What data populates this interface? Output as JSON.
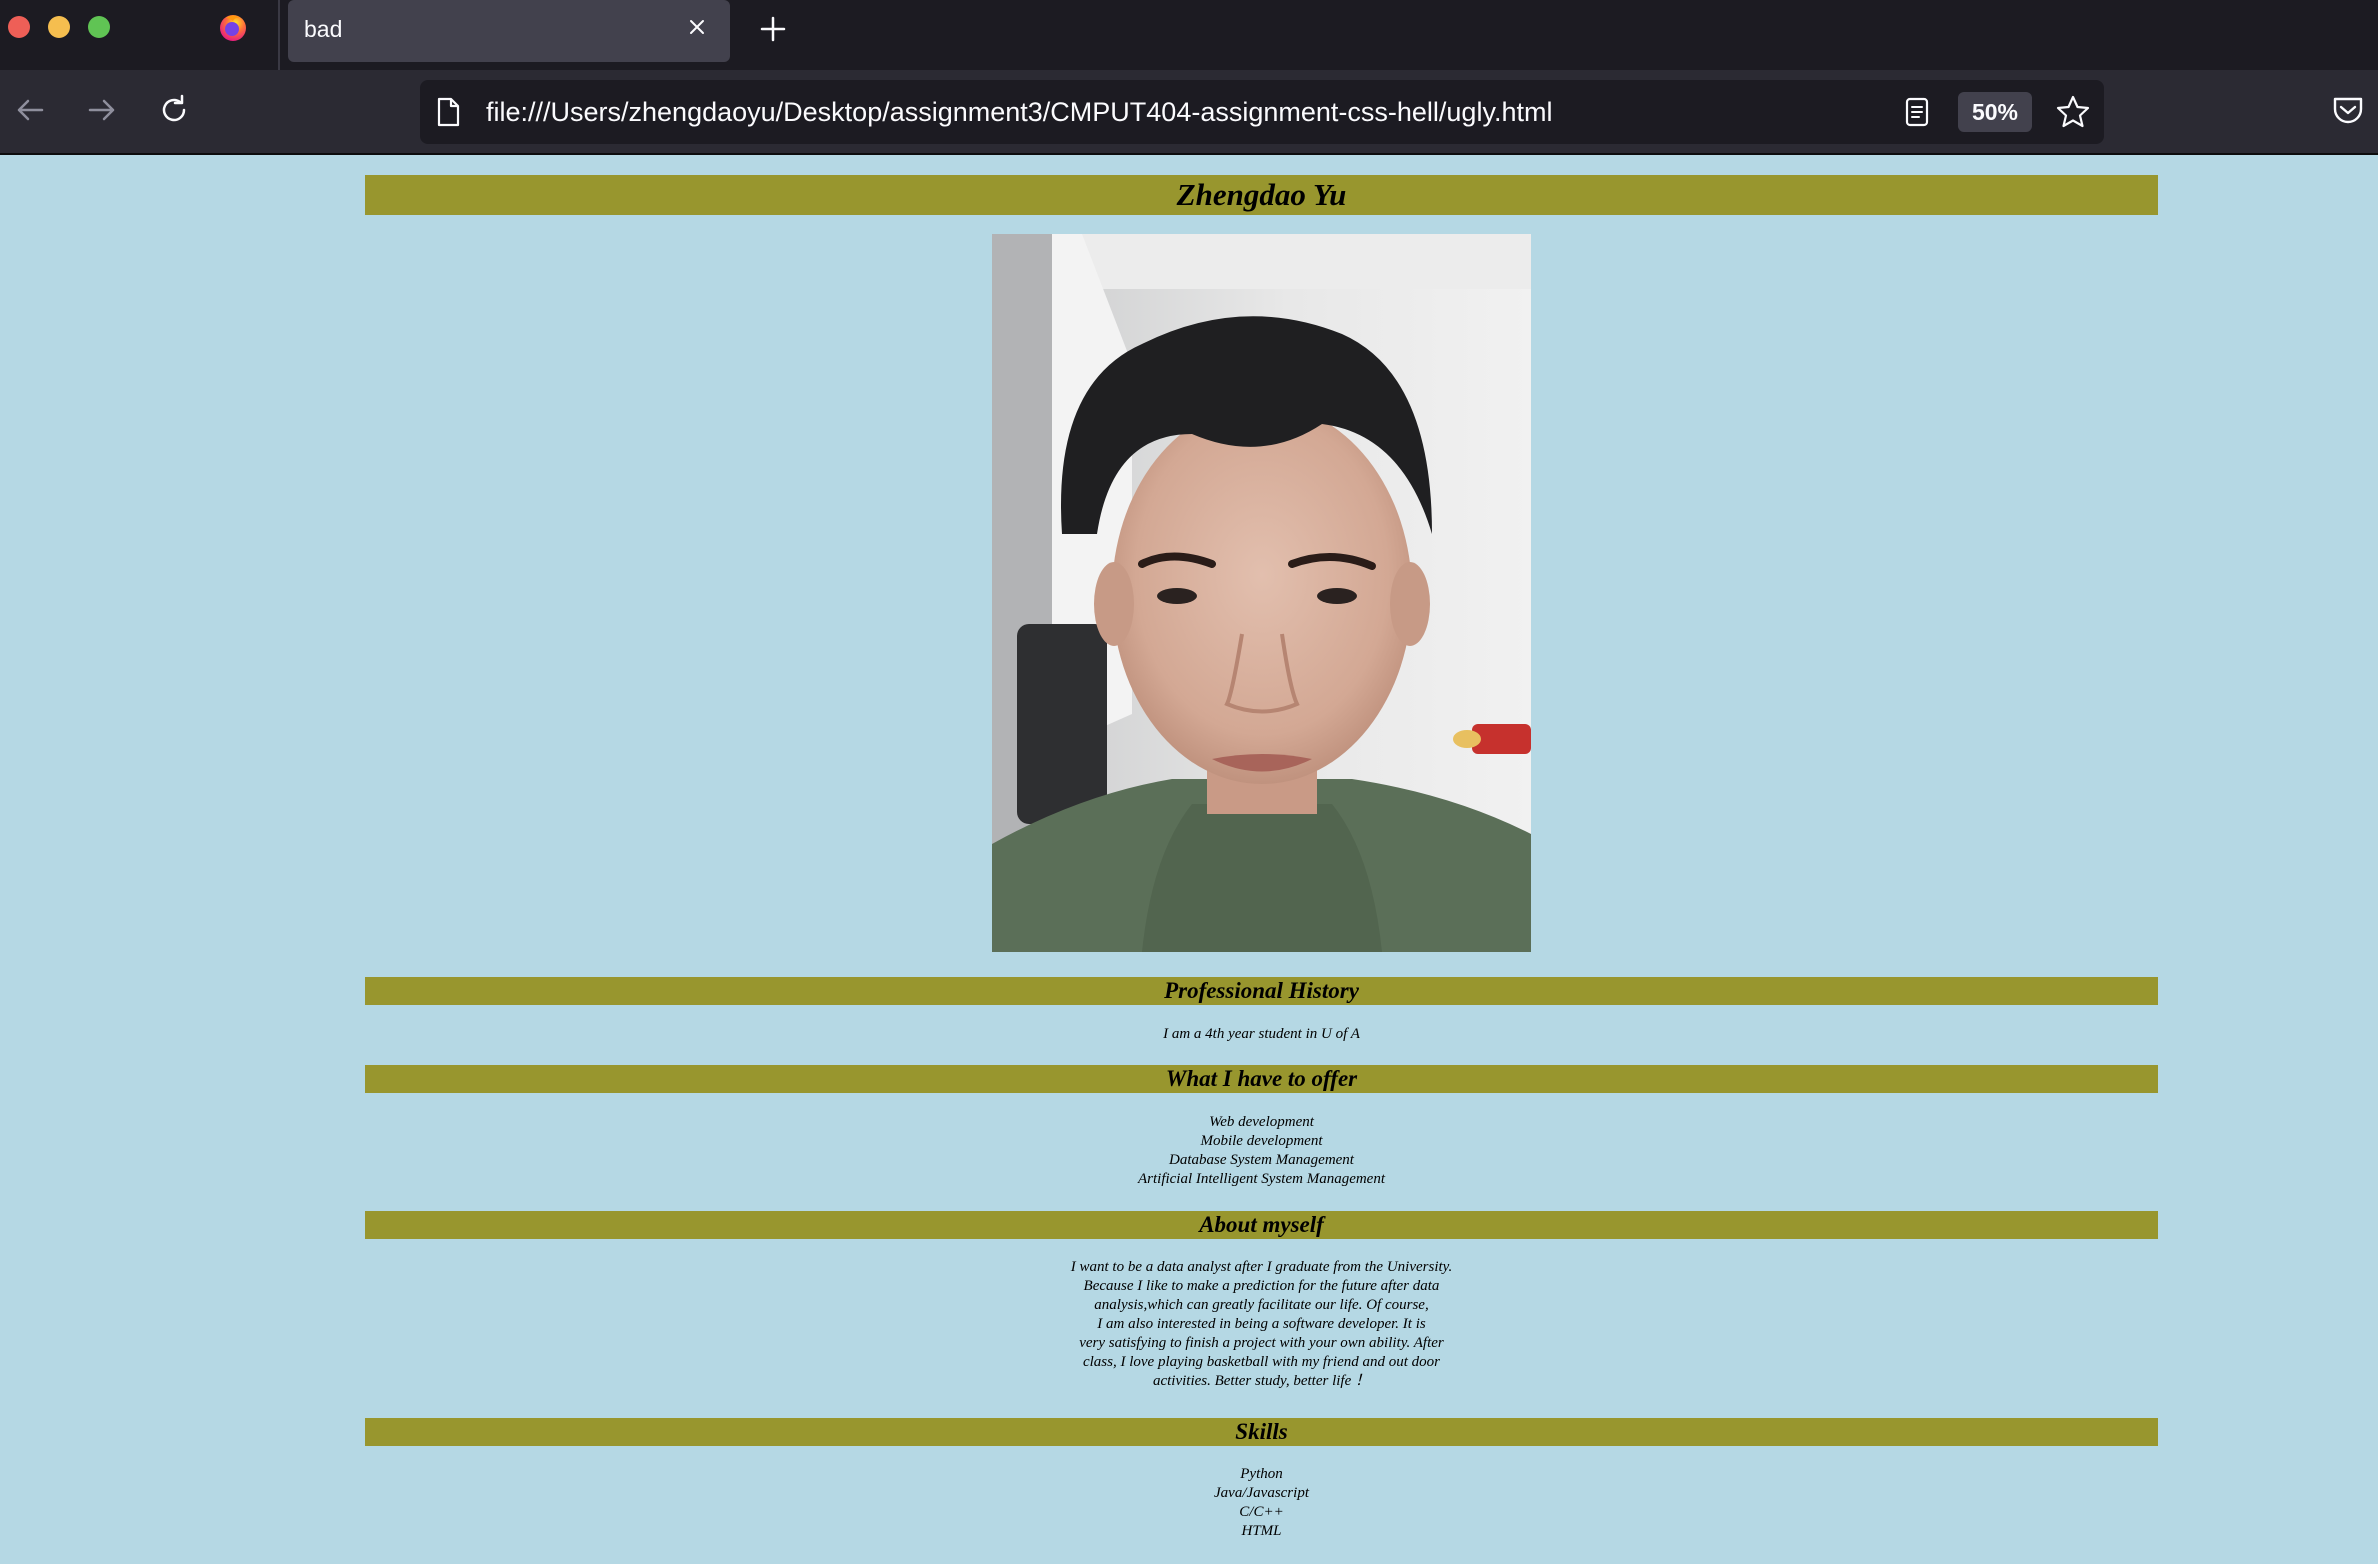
{
  "browser": {
    "tab_title": "bad",
    "url": "file:///Users/zhengdaoyu/Desktop/assignment3/CMPUT404-assignment-css-hell/ugly.html",
    "zoom": "50%"
  },
  "page": {
    "name": "Zhengdao Yu",
    "sections": [
      {
        "heading": "Professional History",
        "lines": [
          "I am a 4th year student in U of A"
        ]
      },
      {
        "heading": "What I have to offer",
        "lines": [
          "Web development",
          "Mobile development",
          "Database System Management",
          "Artificial Intelligent System Management"
        ]
      },
      {
        "heading": "About myself",
        "lines": [
          "I want to be a data analyst after I graduate from the University.",
          "Because I like to make a prediction for the future after data",
          "analysis,which can greatly facilitate our life. Of course,",
          "I am also interested in being a software developer. It is",
          "very satisfying to finish a project with your own ability. After",
          "class, I love playing basketball with my friend and out door",
          "activities. Better study, better life ！"
        ]
      },
      {
        "heading": "Skills",
        "lines": [
          "Python",
          "Java/Javascript",
          "C/C++",
          "HTML"
        ]
      }
    ]
  },
  "colors": {
    "page_background": "#b5d8e4",
    "heading_bar": "#98962e",
    "browser_chrome": "#1c1b22"
  },
  "icons": [
    "firefox-logo-icon",
    "close-tab-icon",
    "new-tab-icon",
    "back-arrow-icon",
    "forward-arrow-icon",
    "reload-icon",
    "page-icon",
    "reader-view-icon",
    "bookmark-star-icon",
    "pocket-icon"
  ]
}
